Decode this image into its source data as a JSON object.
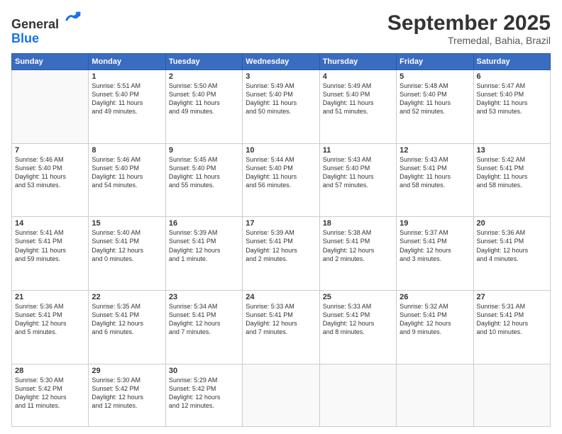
{
  "header": {
    "logo_general": "General",
    "logo_blue": "Blue",
    "month_title": "September 2025",
    "location": "Tremedal, Bahia, Brazil"
  },
  "weekdays": [
    "Sunday",
    "Monday",
    "Tuesday",
    "Wednesday",
    "Thursday",
    "Friday",
    "Saturday"
  ],
  "weeks": [
    [
      {
        "day": "",
        "info": ""
      },
      {
        "day": "1",
        "info": "Sunrise: 5:51 AM\nSunset: 5:40 PM\nDaylight: 11 hours\nand 49 minutes."
      },
      {
        "day": "2",
        "info": "Sunrise: 5:50 AM\nSunset: 5:40 PM\nDaylight: 11 hours\nand 49 minutes."
      },
      {
        "day": "3",
        "info": "Sunrise: 5:49 AM\nSunset: 5:40 PM\nDaylight: 11 hours\nand 50 minutes."
      },
      {
        "day": "4",
        "info": "Sunrise: 5:49 AM\nSunset: 5:40 PM\nDaylight: 11 hours\nand 51 minutes."
      },
      {
        "day": "5",
        "info": "Sunrise: 5:48 AM\nSunset: 5:40 PM\nDaylight: 11 hours\nand 52 minutes."
      },
      {
        "day": "6",
        "info": "Sunrise: 5:47 AM\nSunset: 5:40 PM\nDaylight: 11 hours\nand 53 minutes."
      }
    ],
    [
      {
        "day": "7",
        "info": "Sunrise: 5:46 AM\nSunset: 5:40 PM\nDaylight: 11 hours\nand 53 minutes."
      },
      {
        "day": "8",
        "info": "Sunrise: 5:46 AM\nSunset: 5:40 PM\nDaylight: 11 hours\nand 54 minutes."
      },
      {
        "day": "9",
        "info": "Sunrise: 5:45 AM\nSunset: 5:40 PM\nDaylight: 11 hours\nand 55 minutes."
      },
      {
        "day": "10",
        "info": "Sunrise: 5:44 AM\nSunset: 5:40 PM\nDaylight: 11 hours\nand 56 minutes."
      },
      {
        "day": "11",
        "info": "Sunrise: 5:43 AM\nSunset: 5:40 PM\nDaylight: 11 hours\nand 57 minutes."
      },
      {
        "day": "12",
        "info": "Sunrise: 5:43 AM\nSunset: 5:41 PM\nDaylight: 11 hours\nand 58 minutes."
      },
      {
        "day": "13",
        "info": "Sunrise: 5:42 AM\nSunset: 5:41 PM\nDaylight: 11 hours\nand 58 minutes."
      }
    ],
    [
      {
        "day": "14",
        "info": "Sunrise: 5:41 AM\nSunset: 5:41 PM\nDaylight: 11 hours\nand 59 minutes."
      },
      {
        "day": "15",
        "info": "Sunrise: 5:40 AM\nSunset: 5:41 PM\nDaylight: 12 hours\nand 0 minutes."
      },
      {
        "day": "16",
        "info": "Sunrise: 5:39 AM\nSunset: 5:41 PM\nDaylight: 12 hours\nand 1 minute."
      },
      {
        "day": "17",
        "info": "Sunrise: 5:39 AM\nSunset: 5:41 PM\nDaylight: 12 hours\nand 2 minutes."
      },
      {
        "day": "18",
        "info": "Sunrise: 5:38 AM\nSunset: 5:41 PM\nDaylight: 12 hours\nand 2 minutes."
      },
      {
        "day": "19",
        "info": "Sunrise: 5:37 AM\nSunset: 5:41 PM\nDaylight: 12 hours\nand 3 minutes."
      },
      {
        "day": "20",
        "info": "Sunrise: 5:36 AM\nSunset: 5:41 PM\nDaylight: 12 hours\nand 4 minutes."
      }
    ],
    [
      {
        "day": "21",
        "info": "Sunrise: 5:36 AM\nSunset: 5:41 PM\nDaylight: 12 hours\nand 5 minutes."
      },
      {
        "day": "22",
        "info": "Sunrise: 5:35 AM\nSunset: 5:41 PM\nDaylight: 12 hours\nand 6 minutes."
      },
      {
        "day": "23",
        "info": "Sunrise: 5:34 AM\nSunset: 5:41 PM\nDaylight: 12 hours\nand 7 minutes."
      },
      {
        "day": "24",
        "info": "Sunrise: 5:33 AM\nSunset: 5:41 PM\nDaylight: 12 hours\nand 7 minutes."
      },
      {
        "day": "25",
        "info": "Sunrise: 5:33 AM\nSunset: 5:41 PM\nDaylight: 12 hours\nand 8 minutes."
      },
      {
        "day": "26",
        "info": "Sunrise: 5:32 AM\nSunset: 5:41 PM\nDaylight: 12 hours\nand 9 minutes."
      },
      {
        "day": "27",
        "info": "Sunrise: 5:31 AM\nSunset: 5:41 PM\nDaylight: 12 hours\nand 10 minutes."
      }
    ],
    [
      {
        "day": "28",
        "info": "Sunrise: 5:30 AM\nSunset: 5:42 PM\nDaylight: 12 hours\nand 11 minutes."
      },
      {
        "day": "29",
        "info": "Sunrise: 5:30 AM\nSunset: 5:42 PM\nDaylight: 12 hours\nand 12 minutes."
      },
      {
        "day": "30",
        "info": "Sunrise: 5:29 AM\nSunset: 5:42 PM\nDaylight: 12 hours\nand 12 minutes."
      },
      {
        "day": "",
        "info": ""
      },
      {
        "day": "",
        "info": ""
      },
      {
        "day": "",
        "info": ""
      },
      {
        "day": "",
        "info": ""
      }
    ]
  ]
}
